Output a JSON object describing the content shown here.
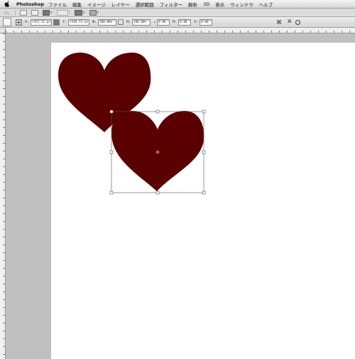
{
  "menubar": {
    "app_name": "Photoshop",
    "items": [
      "ファイル",
      "編集",
      "イメージ",
      "レイヤー",
      "選択範囲",
      "フィルター",
      "解析",
      "3D",
      "表示",
      "ウィンドウ",
      "ヘルプ"
    ]
  },
  "appbar": {
    "icons": [
      "ps-logo-icon",
      "bridge-icon",
      "mini-bridge-icon",
      "screen-mode-icon",
      "zoom-level-icon",
      "arrange-documents-icon",
      "screen-mode-select-icon"
    ]
  },
  "options": {
    "x_label": "X:",
    "x_value": "+351.11 px",
    "y_label": "Y:",
    "y_value": "+184.13 px",
    "w_label": "W:",
    "w_value": "100.00%",
    "h_label": "H:",
    "h_value": "100.00%",
    "angle_value": "0.00",
    "h_skew_label": "H:",
    "h_skew_value": "0.00",
    "v_skew_label": "V:",
    "v_skew_value": "0.00"
  },
  "colors": {
    "heart_fill": "#5a0000",
    "canvas": "#ffffff",
    "workspace": "#bfbfbf"
  }
}
